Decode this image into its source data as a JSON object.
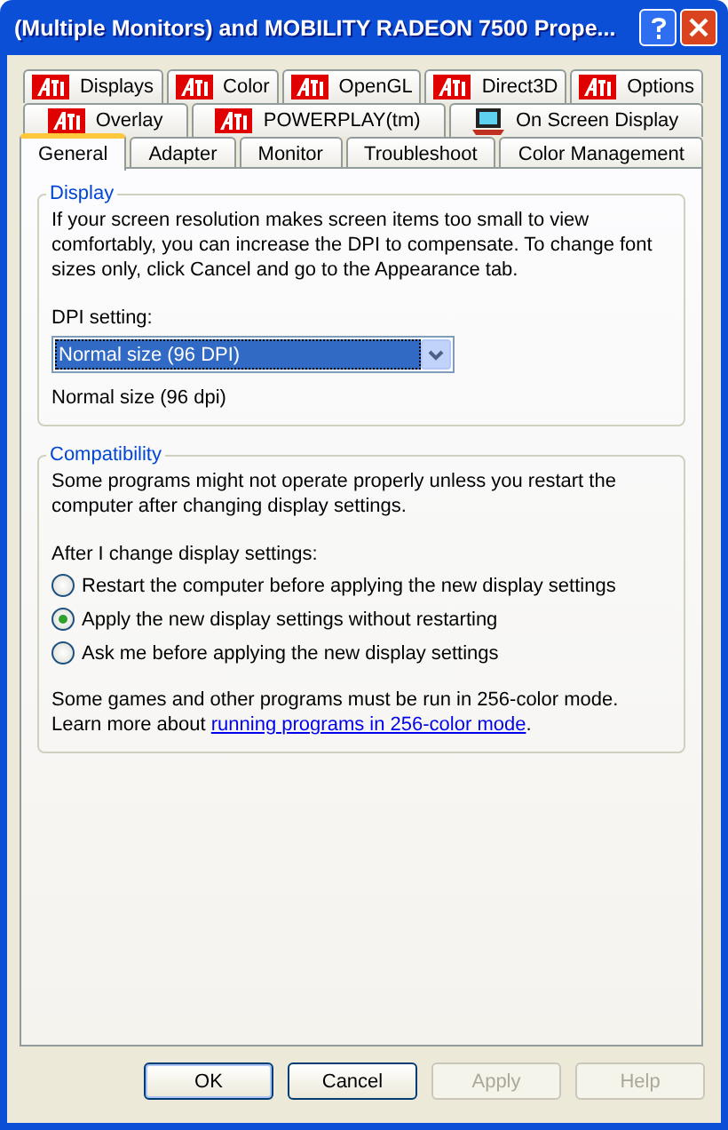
{
  "window": {
    "title": "(Multiple Monitors) and MOBILITY RADEON 7500 Prope..."
  },
  "tab_rows": [
    [
      {
        "label": "Displays",
        "kind": "ati",
        "selected": false
      },
      {
        "label": "Color",
        "kind": "ati",
        "selected": false
      },
      {
        "label": "OpenGL",
        "kind": "ati",
        "selected": false
      },
      {
        "label": "Direct3D",
        "kind": "ati",
        "selected": false
      },
      {
        "label": "Options",
        "kind": "ati",
        "selected": false
      }
    ],
    [
      {
        "label": "Overlay",
        "kind": "ati",
        "selected": false
      },
      {
        "label": "POWERPLAY(tm)",
        "kind": "ati",
        "selected": false
      },
      {
        "label": "On Screen Display",
        "kind": "monitor",
        "selected": false
      }
    ],
    [
      {
        "label": "General",
        "kind": "plain",
        "selected": true
      },
      {
        "label": "Adapter",
        "kind": "plain",
        "selected": false
      },
      {
        "label": "Monitor",
        "kind": "plain",
        "selected": false
      },
      {
        "label": "Troubleshoot",
        "kind": "plain",
        "selected": false
      },
      {
        "label": "Color Management",
        "kind": "plain",
        "selected": false
      }
    ]
  ],
  "display_group": {
    "title": "Display",
    "description": "If your screen resolution makes screen items too small to view comfortably, you can increase the DPI to compensate.  To change font sizes only, click Cancel and go to the Appearance tab.",
    "dpi_label": "DPI setting:",
    "dpi_value": "Normal size (96 DPI)",
    "dpi_note": "Normal size (96 dpi)"
  },
  "compatibility_group": {
    "title": "Compatibility",
    "description": "Some programs might not operate properly unless you restart the computer after changing display settings.",
    "options_label": "After I change display settings:",
    "options": [
      {
        "label": "Restart the computer before applying the new display settings",
        "selected": false
      },
      {
        "label": "Apply the new display settings without restarting",
        "selected": true
      },
      {
        "label": "Ask me before applying the new display settings",
        "selected": false
      }
    ],
    "note": "Some games and other programs must be run in 256-color mode.",
    "learn_more": "Learn more about ",
    "link": "running programs in 256-color mode",
    "link_end": "."
  },
  "buttons": [
    {
      "label": "OK",
      "disabled": false,
      "default": true
    },
    {
      "label": "Cancel",
      "disabled": false,
      "default": false
    },
    {
      "label": "Apply",
      "disabled": true,
      "default": false
    },
    {
      "label": "Help",
      "disabled": true,
      "default": false
    }
  ]
}
